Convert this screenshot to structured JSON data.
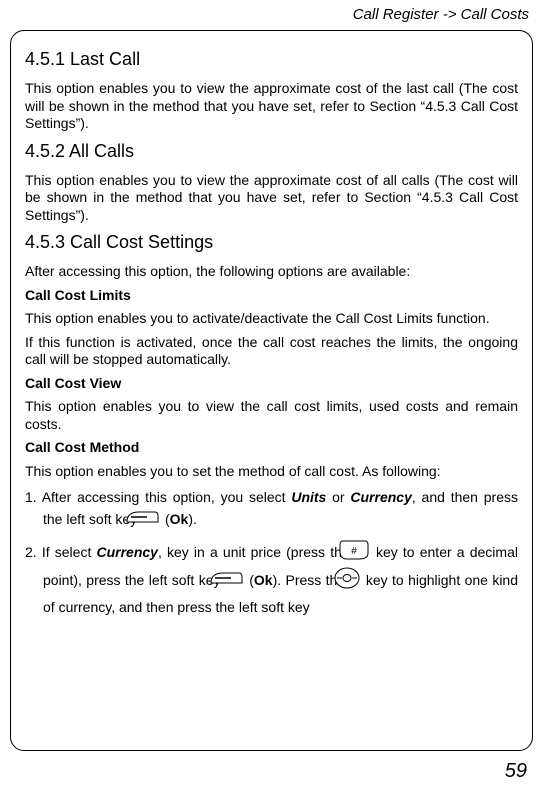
{
  "breadcrumb": "Call Register -> Call Costs",
  "page_number": "59",
  "sections": {
    "s451": {
      "heading": "4.5.1 Last Call",
      "p1a": "This option enables you to view the approximate cost of the last call (The cost will be shown in the method that you have set, refer to Section ",
      "p1b": "“4.5.3 Call Cost Settings”).",
      "__note": "p1a/p1b kept for potential formatting but rendered concatenated"
    },
    "s452": {
      "heading": "4.5.2 All Calls",
      "p1": "This option enables you to view the approximate cost of all calls (The cost will be shown in the method that you have set, refer to Section “4.5.3 Call Cost Settings”)."
    },
    "s453": {
      "heading": "4.5.3 Call Cost Settings",
      "intro": "After accessing this option, the following options are available:",
      "limits_h": "Call Cost Limits",
      "limits_p1": "This option enables you to activate/deactivate the Call Cost Limits function.",
      "limits_p2": "If this function is activated, once the call cost reaches the limits, the ongoing call will be stopped automatically.",
      "view_h": "Call Cost View",
      "view_p1": "This option enables you to view the call cost limits, used costs and remain costs.",
      "method_h": "Call Cost Method",
      "method_p1": "This option enables you to set the method of call cost. As following:",
      "step1_a": "1. After accessing this option, you select ",
      "step1_units": "Units",
      "step1_or": " or ",
      "step1_currency": "Currency",
      "step1_b": ", and then press the left soft key ",
      "step1_c": " (",
      "step1_ok": "Ok",
      "step1_d": ").",
      "step2_a": "2. If select ",
      "step2_currency": "Currency",
      "step2_b": ", key in a unit price (press the ",
      "step2_c": " key to enter a decimal point), press the left soft key ",
      "step2_d": " (",
      "step2_ok": "Ok",
      "step2_e": "). Press the ",
      "step2_f": " key to highlight one kind of currency, and then press the left soft key"
    }
  }
}
